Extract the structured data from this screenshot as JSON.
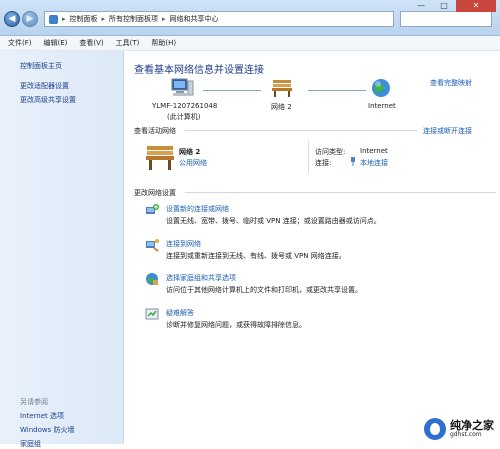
{
  "breadcrumb": [
    "控制面板",
    "所有控制面板项",
    "网络和共享中心"
  ],
  "menu": [
    "文件(F)",
    "编辑(E)",
    "查看(V)",
    "工具(T)",
    "帮助(H)"
  ],
  "sidebar": {
    "links": [
      "控制面板主页",
      "更改适配器设置",
      "更改高级共享设置"
    ],
    "see_also_heading": "另请参阅",
    "see_also": [
      "Internet 选项",
      "Windows 防火墙",
      "家庭组"
    ]
  },
  "main": {
    "title": "查看基本网络信息并设置连接",
    "view_full_map": "查看完整映射",
    "map": {
      "computer_name": "YLMF-1207261048",
      "computer_sub": "(此计算机)",
      "network_name": "网络  2",
      "internet": "Internet"
    },
    "active_heading": "查看活动网络",
    "connect_disconnect": "连接或断开连接",
    "network": {
      "name": "网络  2",
      "type": "公用网络",
      "access_label": "访问类型:",
      "access_value": "Internet",
      "conn_label": "连接:",
      "conn_value": "本地连接"
    },
    "change_heading": "更改网络设置",
    "tasks": [
      {
        "title": "设置新的连接或网络",
        "desc": "设置无线、宽带、拨号、临时或 VPN 连接；或设置路由器或访问点。"
      },
      {
        "title": "连接到网络",
        "desc": "连接到或重新连接到无线、有线、拨号或 VPN 网络连接。"
      },
      {
        "title": "选择家庭组和共享选项",
        "desc": "访问位于其他网络计算机上的文件和打印机，或更改共享设置。"
      },
      {
        "title": "疑难解答",
        "desc": "诊断并修复网络问题，或获得故障排除信息。"
      }
    ]
  },
  "watermark": {
    "brand": "纯净之家",
    "url": "gdhst.com"
  },
  "colors": {
    "link": "#1a5fb4",
    "heading": "#1e3b8c",
    "sidebar_bg": "#dce9f7"
  }
}
